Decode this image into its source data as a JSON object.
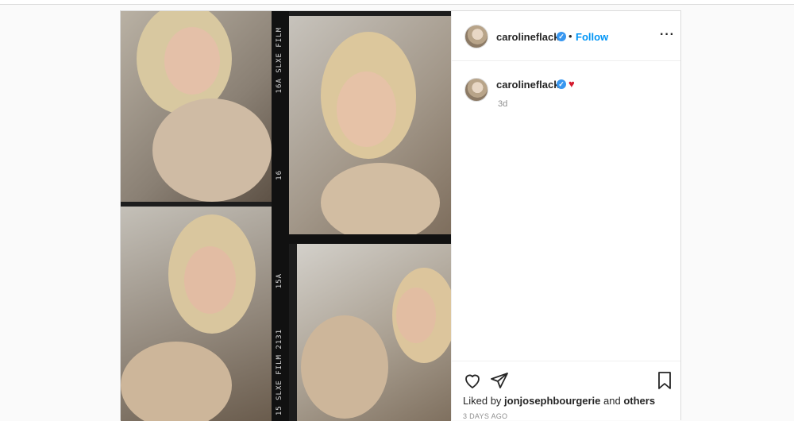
{
  "post": {
    "username": "carolineflack",
    "verified_symbol": "✓",
    "separator": "•",
    "follow_label": "Follow",
    "more_label": "···",
    "caption_emoji": "♥",
    "caption_time": "3d",
    "liked_prefix": "Liked by",
    "liked_user": "jonjosephbourgerie",
    "liked_and": "and",
    "liked_others": "others",
    "posted_ago": "3 DAYS AGO"
  },
  "film": {
    "strip_top": "16A  SLXE FILM",
    "strip_mid": "16",
    "strip_low": "15A",
    "strip_bottom": "15  SLXE FILM 2131"
  },
  "colors": {
    "link": "#0095f6",
    "verified": "#3897f0",
    "heart": "#d51a2e"
  }
}
